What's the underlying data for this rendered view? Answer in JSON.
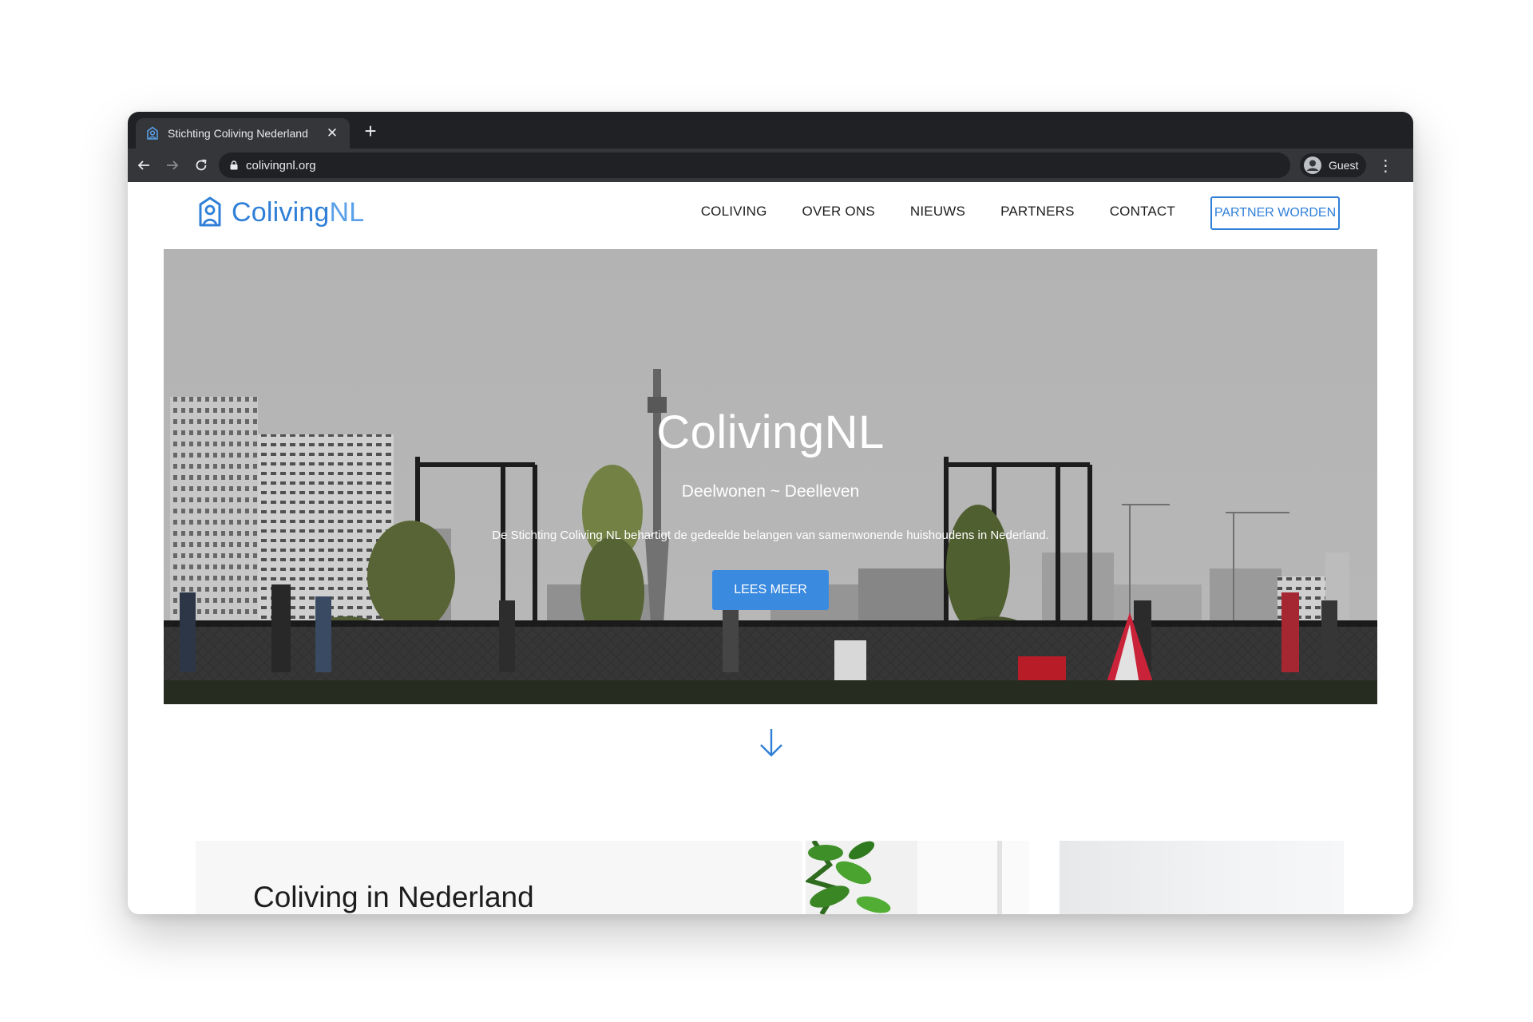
{
  "browser": {
    "tab_title": "Stichting Coliving Nederland",
    "url": "colivingnl.org",
    "profile_label": "Guest"
  },
  "site": {
    "logo_main": "Coliving",
    "logo_suffix": "NL",
    "nav": [
      "COLIVING",
      "OVER ONS",
      "NIEUWS",
      "PARTNERS",
      "CONTACT"
    ],
    "cta_label": "PARTNER WORDEN"
  },
  "hero": {
    "title": "ColivingNL",
    "subtitle": "Deelwonen ~ Deelleven",
    "description": "De Stichting Coliving NL behartigt de gedeelde belangen van samenwonende huishoudens in Nederland.",
    "button_label": "LEES MEER"
  },
  "section": {
    "title": "Coliving in Nederland"
  },
  "colors": {
    "brand_blue": "#2f7fd8",
    "button_blue": "#3a8ae0",
    "chrome_dark": "#202124",
    "chrome_mid": "#35363a"
  },
  "icons": [
    "home-person-icon",
    "close-icon",
    "plus-icon",
    "back-arrow-icon",
    "forward-arrow-icon",
    "reload-icon",
    "lock-icon",
    "guest-profile-icon",
    "kebab-menu-icon",
    "down-arrow-icon"
  ]
}
